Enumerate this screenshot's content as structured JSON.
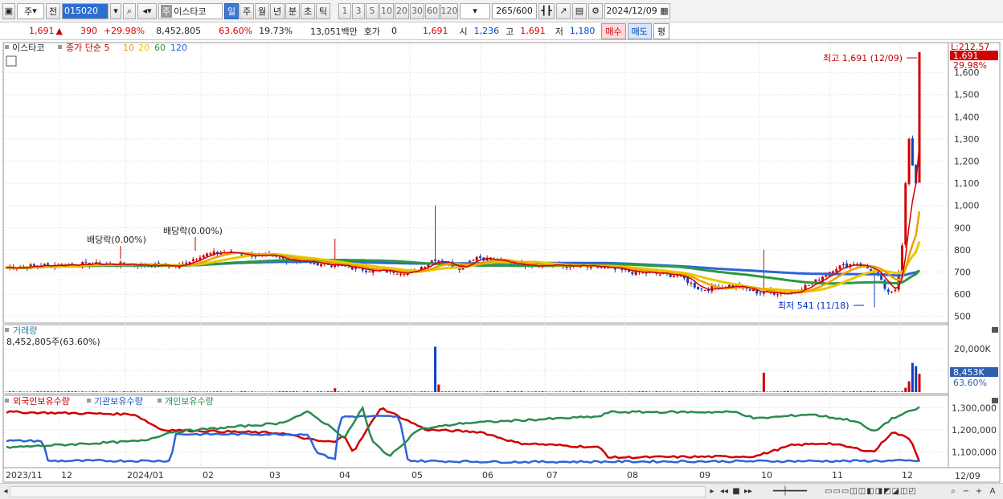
{
  "toolbar": {
    "market": "주",
    "prev": "전",
    "code": "015020",
    "search_icon": "search-icon",
    "name_tag": "주",
    "name": "이스타코",
    "periods": [
      "일",
      "주",
      "월",
      "년",
      "분",
      "초",
      "틱"
    ],
    "active_period": "일",
    "nums": [
      "1",
      "3",
      "5",
      "10",
      "20",
      "30",
      "60",
      "120"
    ],
    "count": "265",
    "count_max": "/600",
    "date": "2024/12/09"
  },
  "quote": {
    "price": "1,691",
    "change": "390",
    "change_pct": "+29.98%",
    "volume": "8,452,805",
    "vol_ratio": "63.60%",
    "turnover": "19.73%",
    "amount": "13,051백만",
    "hoga_label": "호가",
    "hoga": "0",
    "hoga_price": "1,691",
    "open_label": "시",
    "open": "1,236",
    "high_label": "고",
    "high": "1,691",
    "low_label": "저",
    "low": "1,180",
    "buy": "매수",
    "sell": "매도",
    "flat": "평"
  },
  "price_panel": {
    "legend_name": "이스타코",
    "legend_ma": "종가 단순 5",
    "ma_labels": [
      "10",
      "20",
      "60",
      "120"
    ],
    "ma_colors": [
      "#e8a000",
      "#e8c800",
      "#2a9a40",
      "#2060d0"
    ],
    "right_top": "L:212.57",
    "last_price": "1,691",
    "last_pct": "29.98%",
    "high_annot": "최고 1,691 (12/09)",
    "low_annot": "최저 541 (11/18)",
    "div1": "배당락(0.00%)",
    "div2": "배당락(0.00%)",
    "yticks": [
      "1,600",
      "1,500",
      "1,400",
      "1,300",
      "1,200",
      "1,100",
      "1,000",
      "900",
      "800",
      "700",
      "600",
      "500"
    ]
  },
  "volume_panel": {
    "title": "거래량",
    "value": "8,452,805주(63.60%)",
    "yticks": [
      "20,000K",
      "10,000K"
    ],
    "last": "8,453K",
    "last_pct": "63.60%"
  },
  "holder_panel": {
    "foreign": "외국인보유수량",
    "inst": "기관보유수량",
    "indiv": "개인보유수량",
    "yticks": [
      "1,300,000",
      "1,200,000",
      "1,100,000"
    ]
  },
  "xaxis": [
    "2023/11",
    "12",
    "2024/01",
    "02",
    "03",
    "04",
    "05",
    "06",
    "07",
    "08",
    "09",
    "10",
    "11",
    "12"
  ],
  "xaxis_right": "12/09",
  "chart_data": {
    "type": "line",
    "title": "",
    "xlabel": "",
    "ylabel": "",
    "ylim": [
      470,
      1720
    ],
    "x": [
      "2023/11",
      "12",
      "2024/01",
      "02",
      "03",
      "04",
      "05",
      "06",
      "07",
      "08",
      "09",
      "10",
      "11",
      "12",
      "12/09"
    ],
    "series": [
      {
        "name": "이스타코",
        "values": [
          740,
          735,
          745,
          760,
          710,
          760,
          730,
          700,
          690,
          640,
          600,
          650,
          700,
          640,
          1691
        ]
      },
      {
        "name": "120",
        "values": [
          780,
          765,
          750,
          748,
          745,
          744,
          742,
          738,
          730,
          720,
          705,
          690,
          670,
          660,
          680
        ]
      },
      {
        "name": "60",
        "values": [
          720,
          730,
          735,
          740,
          738,
          740,
          735,
          725,
          705,
          690,
          670,
          655,
          660,
          650,
          680
        ]
      }
    ]
  }
}
